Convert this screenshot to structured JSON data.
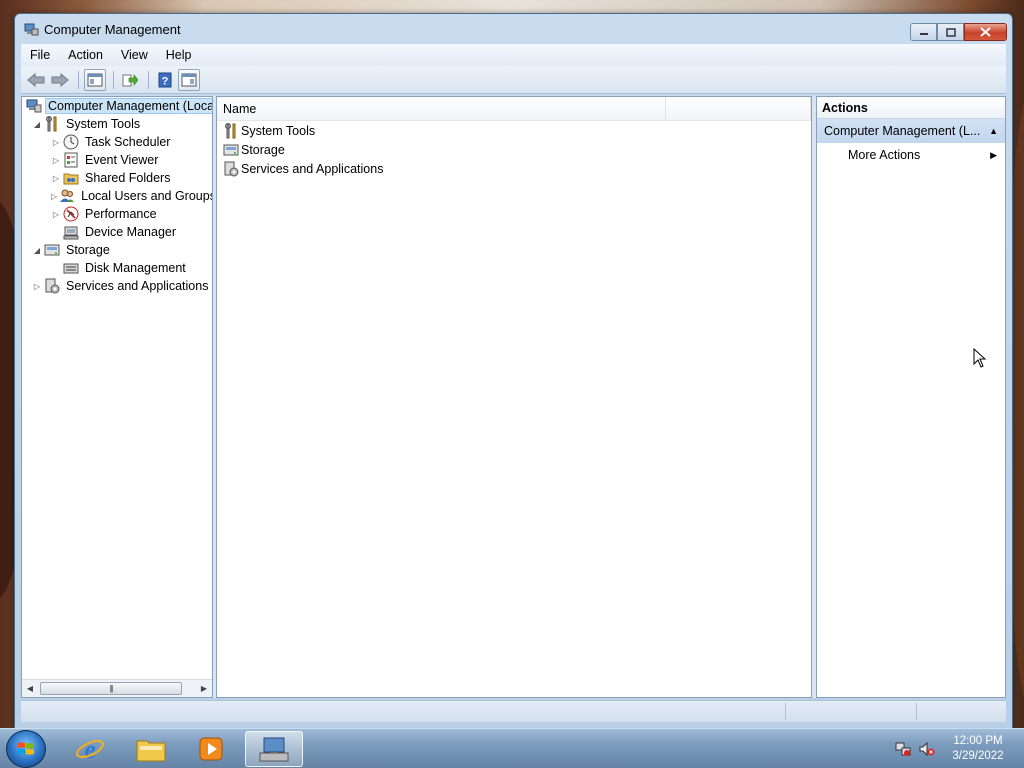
{
  "window": {
    "title": "Computer Management",
    "buttons": {
      "minimize": "minimize",
      "maximize": "maximize",
      "close": "close"
    }
  },
  "menu": [
    "File",
    "Action",
    "View",
    "Help"
  ],
  "toolbar": [
    "back-icon",
    "forward-icon",
    "show-hide-console-tree-icon",
    "export-list-icon",
    "help-icon",
    "show-hide-action-pane-icon"
  ],
  "tree": {
    "root": "Computer Management (Local",
    "system_tools": "System Tools",
    "task_scheduler": "Task Scheduler",
    "event_viewer": "Event Viewer",
    "shared_folders": "Shared Folders",
    "local_users": "Local Users and Groups",
    "performance": "Performance",
    "device_manager": "Device Manager",
    "storage": "Storage",
    "disk_management": "Disk Management",
    "services_apps": "Services and Applications"
  },
  "list": {
    "column_name": "Name",
    "items": [
      "System Tools",
      "Storage",
      "Services and Applications"
    ]
  },
  "actions": {
    "header": "Actions",
    "section": "Computer Management (L...",
    "more_actions": "More Actions"
  },
  "taskbar": {
    "time": "12:00 PM",
    "date": "3/29/2022",
    "apps": [
      "internet-explorer-icon",
      "windows-explorer-icon",
      "media-player-icon",
      "computer-management-icon"
    ]
  },
  "colors": {
    "selection": "#cce4f7",
    "action_section": "#c2d6ee",
    "close_button": "#c7432a"
  }
}
